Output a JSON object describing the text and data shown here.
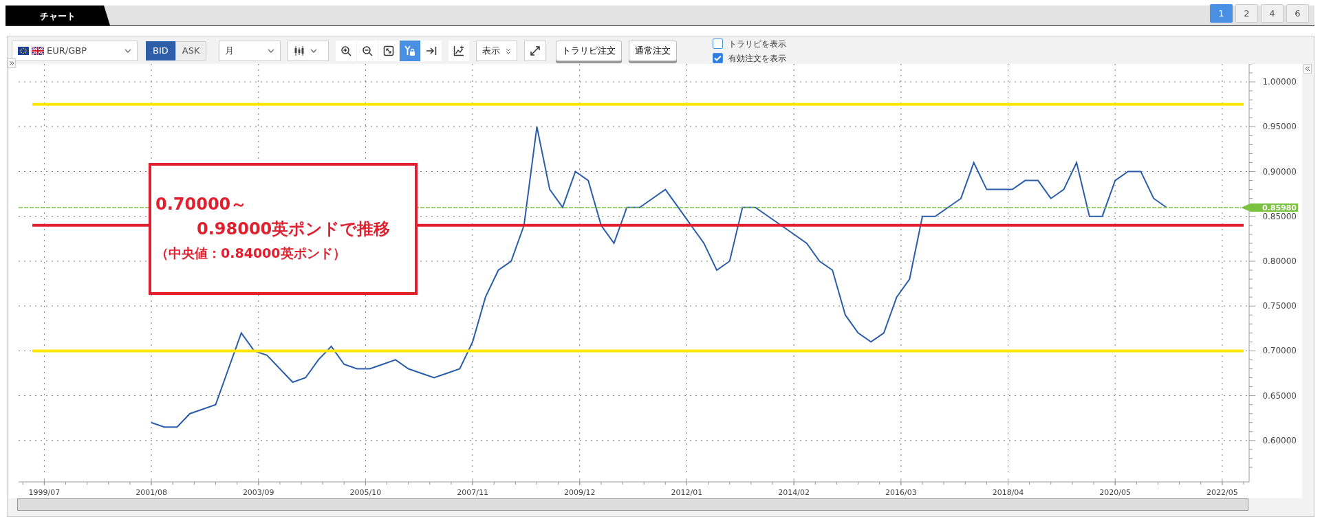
{
  "tabs": [
    {
      "label": "チャート",
      "selected": true
    }
  ],
  "layout_buttons": [
    {
      "label": "1",
      "selected": true
    },
    {
      "label": "2",
      "selected": false
    },
    {
      "label": "4",
      "selected": false
    },
    {
      "label": "6",
      "selected": false
    }
  ],
  "toolbar": {
    "pair": "EUR/GBP",
    "price_side": [
      {
        "label": "BID",
        "selected": true
      },
      {
        "label": "ASK",
        "selected": false
      }
    ],
    "period": "月",
    "tools": [
      {
        "kind": "zoom-in",
        "active": false
      },
      {
        "kind": "zoom-out",
        "active": false
      },
      {
        "kind": "fit",
        "active": false
      },
      {
        "kind": "y-lock",
        "active": true
      },
      {
        "kind": "jump-end",
        "active": false
      }
    ],
    "display_menu": "表示",
    "order_buttons": [
      "トラリピ注文",
      "通常注文"
    ],
    "checkboxes": [
      {
        "label": "トラリピを表示",
        "checked": false
      },
      {
        "label": "有効注文を表示",
        "checked": true
      }
    ]
  },
  "chart": {
    "x_axis_labels": [
      "1999/07",
      "2001/08",
      "2003/09",
      "2005/10",
      "2007/11",
      "2009/12",
      "2012/01",
      "2014/02",
      "2016/03",
      "2018/04",
      "2020/05",
      "2022/05"
    ],
    "callout": [
      "0.70000～",
      "0.98000英ポンドで推移",
      "（中央値：0.84000英ポンド）"
    ],
    "chart_data": {
      "type": "line",
      "series": [
        {
          "color": "#2a5caa",
          "values": [
            0.62,
            0.615,
            0.615,
            0.63,
            0.635,
            0.64,
            0.68,
            0.72,
            0.7,
            0.695,
            0.68,
            0.665,
            0.67,
            0.69,
            0.705,
            0.685,
            0.68,
            0.68,
            0.685,
            0.69,
            0.68,
            0.675,
            0.67,
            0.675,
            0.68,
            0.71,
            0.76,
            0.79,
            0.8,
            0.84,
            0.95,
            0.88,
            0.86,
            0.9,
            0.89,
            0.84,
            0.82,
            0.86,
            0.86,
            0.87,
            0.88,
            0.86,
            0.84,
            0.82,
            0.79,
            0.8,
            0.86,
            0.86,
            0.85,
            0.84,
            0.83,
            0.82,
            0.8,
            0.79,
            0.74,
            0.72,
            0.71,
            0.72,
            0.76,
            0.78,
            0.85,
            0.85,
            0.86,
            0.87,
            0.91,
            0.88,
            0.88,
            0.88,
            0.89,
            0.89,
            0.87,
            0.88,
            0.91,
            0.85,
            0.85,
            0.89,
            0.9,
            0.9,
            0.87,
            0.86
          ]
        }
      ],
      "categories": [
        null,
        null,
        null,
        null,
        null,
        null,
        null,
        null,
        null,
        null,
        null,
        null,
        null,
        null,
        null,
        null,
        null,
        null,
        null,
        null,
        null,
        null,
        null,
        null,
        null,
        null,
        null,
        null,
        null,
        null,
        null,
        null,
        null,
        null,
        null,
        null,
        null,
        null,
        null,
        null,
        null,
        null,
        null,
        null,
        null,
        null,
        null,
        null,
        null,
        null,
        null,
        null,
        null,
        null,
        null,
        null,
        null,
        null,
        null,
        null,
        null,
        null,
        null,
        null,
        null,
        null,
        null,
        null,
        null,
        null,
        null,
        null,
        null,
        null,
        null,
        null,
        null,
        null,
        null,
        null
      ],
      "ylim": [
        0.56,
        1.02
      ],
      "grid": true,
      "yticks": [
        {
          "value": 0.6,
          "label": "0.60000"
        },
        {
          "value": 0.65,
          "label": "0.65000"
        },
        {
          "value": 0.7,
          "label": "0.70000"
        },
        {
          "value": 0.75,
          "label": "0.75000"
        },
        {
          "value": 0.8,
          "label": "0.80000"
        },
        {
          "value": 0.85,
          "label": "0.85000"
        },
        {
          "value": 0.9,
          "label": "0.90000"
        },
        {
          "value": 0.95,
          "label": "0.95000"
        },
        {
          "value": 1.0,
          "label": "1.00000"
        }
      ],
      "ref_lines": [
        {
          "axis": "y",
          "value": 0.975,
          "color": "#ffe600"
        },
        {
          "axis": "y",
          "value": 0.7,
          "color": "#ffe600"
        },
        {
          "axis": "y",
          "value": 0.84,
          "color": "#e0202f"
        },
        {
          "axis": "y",
          "value": 0.8598,
          "label": "0.85980",
          "color": "#7cc242"
        }
      ]
    }
  }
}
